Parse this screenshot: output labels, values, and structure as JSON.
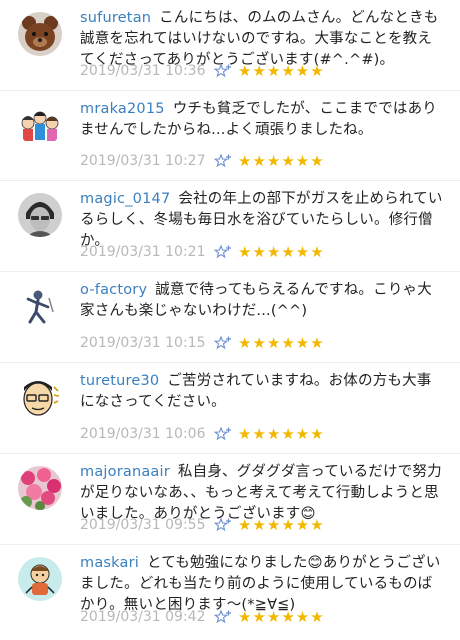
{
  "comments": [
    {
      "user": "sufuretan",
      "text": "こんにちは、のムのムさん。どんなときも誠意を忘れてはいけないのですね。大事なことを教えてくださってありがとうございます(#^.^#)。",
      "date": "2019/03/31 10:36",
      "stars": "★★★★★★",
      "avatar": "teddy-bear"
    },
    {
      "user": "mraka2015",
      "text": "ウチも貧乏でしたが、ここまでではありませんでしたからね...よく頑張りましたね。",
      "date": "2019/03/31 10:27",
      "stars": "★★★★★★",
      "avatar": "family-illustration"
    },
    {
      "user": "magic_0147",
      "text": "会社の年上の部下がガスを止められているらしく、冬場も毎日水を浴びていたらしい。修行僧か。",
      "date": "2019/03/31 10:21",
      "stars": "★★★★★★",
      "avatar": "man-portrait"
    },
    {
      "user": "o-factory",
      "text": "誠意で待ってもらえるんですね。こりゃ大家さんも楽じゃないわけだ...(^^)",
      "date": "2019/03/31 10:15",
      "stars": "★★★★★★",
      "avatar": "ninja-figure"
    },
    {
      "user": "tureture30",
      "text": "ご苦労されていますね。お体の方も大事になさってください。",
      "date": "2019/03/31 10:06",
      "stars": "★★★★★★",
      "avatar": "cartoon-face"
    },
    {
      "user": "majoranaair",
      "text": "私自身、グダグダ言っているだけで努力が足りないなあ、、もっと考えて考えて行動しようと思いました。ありがとうございます😊",
      "date": "2019/03/31 09:55",
      "stars": "★★★★★★",
      "avatar": "flowers"
    },
    {
      "user": "maskari",
      "text": "とても勉強になりました😊ありがとうございました。どれも当たり前のように使用しているものばかり。無いと困ります〜(*≧∀≦)",
      "date": "2019/03/31 09:42",
      "stars": "★★★★★★",
      "avatar": "cartoon-character"
    }
  ]
}
